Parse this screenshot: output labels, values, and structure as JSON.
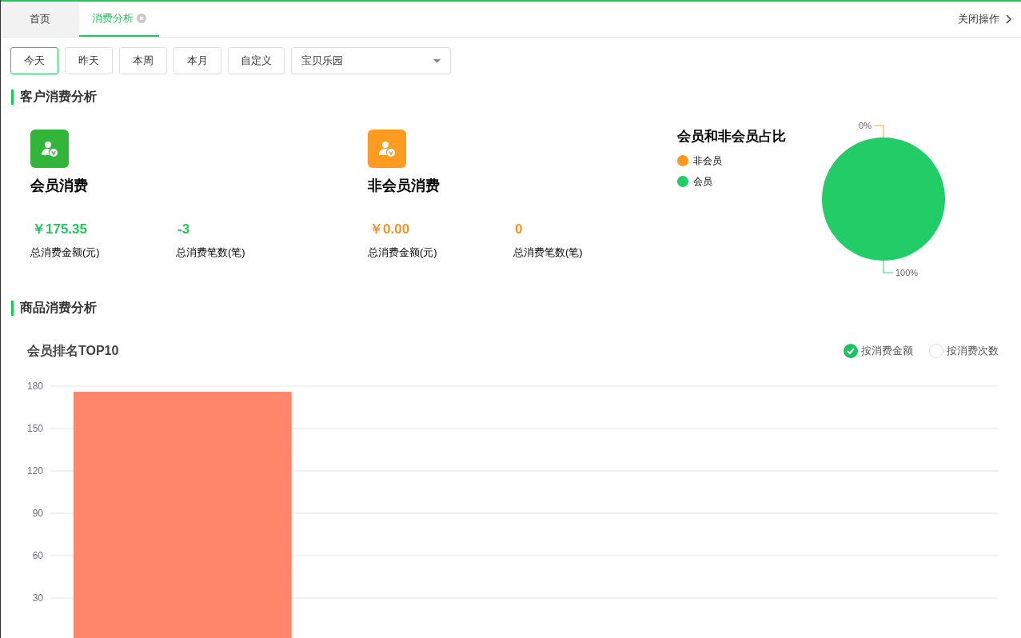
{
  "tabs": [
    {
      "label": "首页",
      "selected": false,
      "closable": false
    },
    {
      "label": "消费分析",
      "selected": true,
      "closable": true
    }
  ],
  "close_ops": "关闭操作",
  "periods": [
    {
      "label": "今天",
      "selected": true
    },
    {
      "label": "昨天",
      "selected": false
    },
    {
      "label": "本周",
      "selected": false
    },
    {
      "label": "本月",
      "selected": false
    },
    {
      "label": "自定义",
      "selected": false
    }
  ],
  "store_select": {
    "value": "宝贝乐园"
  },
  "customer_section": {
    "title": "客户消费分析",
    "cards": [
      {
        "kind": "member",
        "title": "会员消费",
        "stats": [
          {
            "value": "￥175.35",
            "label": "总消费金额(元)"
          },
          {
            "value": "-3",
            "label": "总消费笔数(笔)"
          }
        ]
      },
      {
        "kind": "guest",
        "title": "非会员消费",
        "stats": [
          {
            "value": "￥0.00",
            "label": "总消费金额(元)"
          },
          {
            "value": "0",
            "label": "总消费笔数(笔)"
          }
        ]
      }
    ],
    "ratio": {
      "title": "会员和非会员占比",
      "legend": [
        {
          "label": "非会员",
          "color": "#ff9a1f"
        },
        {
          "label": "会员",
          "color": "#22cc66"
        }
      ],
      "chart_data": {
        "type": "pie",
        "values": [
          0,
          100
        ],
        "value_labels": [
          "0%",
          "100%"
        ]
      }
    }
  },
  "product_section": {
    "title": "商品消费分析",
    "chart_title": "会员排名TOP10",
    "options": [
      {
        "label": "按消费金额",
        "selected": true
      },
      {
        "label": "按消费次数",
        "selected": false
      }
    ],
    "chart_data": {
      "type": "bar",
      "values": [
        176
      ],
      "ylim": [
        0,
        180
      ],
      "yticks": [
        30,
        60,
        90,
        120,
        150,
        180
      ],
      "grid": true
    }
  }
}
